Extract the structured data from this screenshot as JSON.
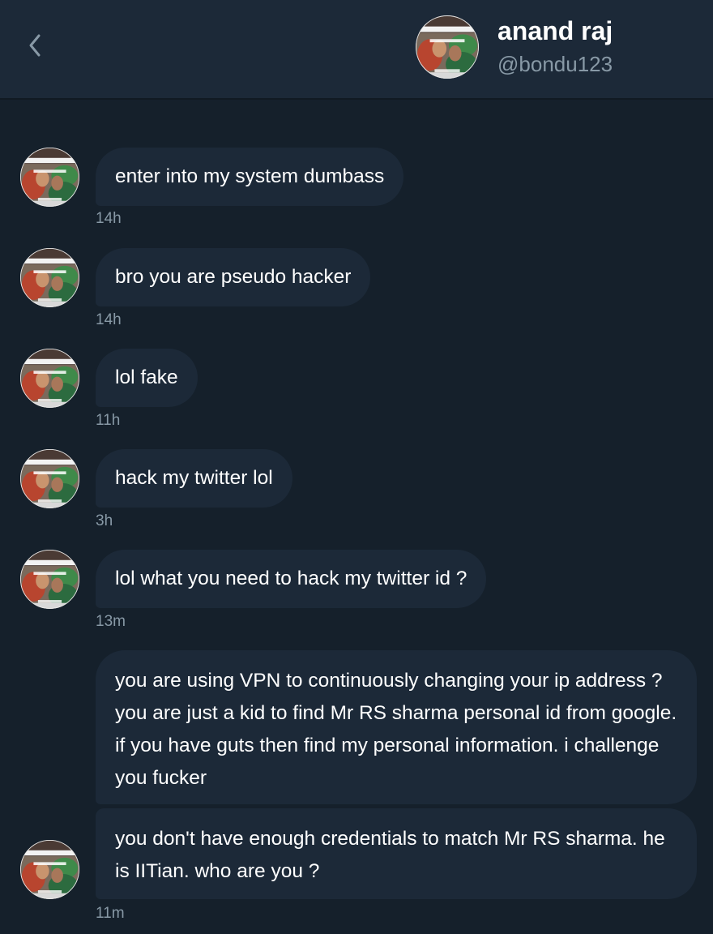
{
  "header": {
    "name": "anand raj",
    "handle": "@bondu123"
  },
  "messages": [
    {
      "text": "enter into my system dumbass",
      "time": "14h"
    },
    {
      "text": "bro you are pseudo hacker",
      "time": "14h"
    },
    {
      "text": "lol fake",
      "time": "11h"
    },
    {
      "text": "hack my twitter lol",
      "time": "3h"
    },
    {
      "text": "lol what you need to hack my twitter id ?",
      "time": "13m"
    },
    {
      "text": "you are using VPN to continuously changing your ip address ? you are just a kid to find Mr RS sharma personal id from google. if you have guts then find my personal information. i challenge you fucker"
    },
    {
      "text": "you don't have enough credentials to match Mr RS sharma. he is IITian. who are you ?",
      "time": "11m"
    }
  ],
  "colors": {
    "background": "#15202b",
    "bubble": "#1c2938",
    "secondary_text": "#8899a6"
  }
}
